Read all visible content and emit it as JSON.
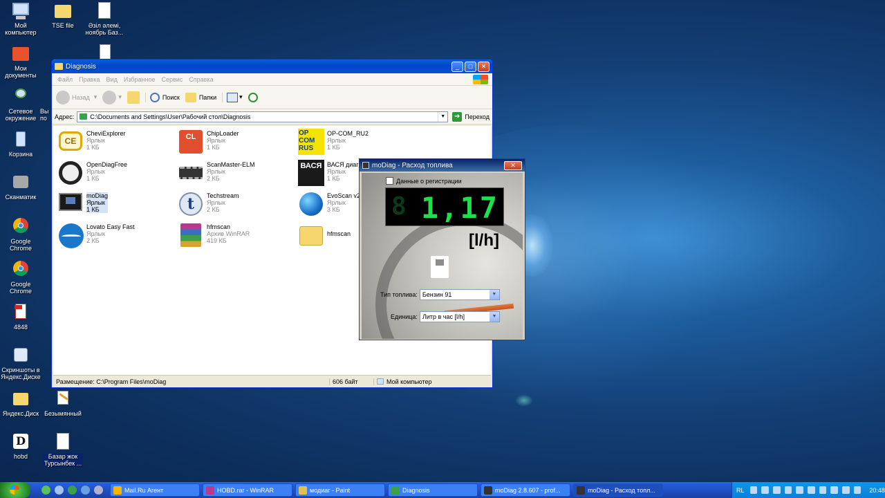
{
  "desktop": {
    "icons": [
      {
        "label": "Мой компьютер"
      },
      {
        "label": "TSE file"
      },
      {
        "label": "Әзіл әлемі, ноябрь Баз..."
      },
      {
        "label": "Мои документы"
      },
      {
        "label": "Сетевое окружение"
      },
      {
        "label": "Корзина"
      },
      {
        "label": "Сканматик"
      },
      {
        "label": "Google Chrome"
      },
      {
        "label": "Google Chrome"
      },
      {
        "label": "4848"
      },
      {
        "label": "Скриншоты в Яндекс.Диске"
      },
      {
        "label": "Яндекс.Диск"
      },
      {
        "label": "Безымянный"
      },
      {
        "label": "hobd"
      },
      {
        "label": "Базар жок Турсынбек ..."
      }
    ],
    "partial_label": "Вы по"
  },
  "explorer": {
    "title": "Diagnosis",
    "menu": [
      "Файл",
      "Правка",
      "Вид",
      "Избранное",
      "Сервис",
      "Справка"
    ],
    "toolbar": {
      "back": "Назад",
      "search": "Поиск",
      "folders": "Папки"
    },
    "address_label": "Адрес:",
    "address_value": "C:\\Documents and Settings\\User\\Рабочий стол\\Diagnosis",
    "go_label": "Переход",
    "files": [
      {
        "name": "CheviExplorer",
        "type": "Ярлык",
        "size": "1 КБ"
      },
      {
        "name": "ChipLoader",
        "type": "Ярлык",
        "size": "1 КБ"
      },
      {
        "name": "OP-COM_RU2",
        "type": "Ярлык",
        "size": "1 КБ"
      },
      {
        "name": "OpenDiagFree",
        "type": "Ярлык",
        "size": "1 КБ"
      },
      {
        "name": "ScanMaster-ELM",
        "type": "Ярлык",
        "size": "2 КБ"
      },
      {
        "name": "ВАСЯ диагн",
        "type": "Ярлык",
        "size": "1 КБ"
      },
      {
        "name": "moDiag",
        "type": "Ярлык",
        "size": "1 КБ"
      },
      {
        "name": "Techstream",
        "type": "Ярлык",
        "size": "2 КБ"
      },
      {
        "name": "EvoScan v2",
        "type": "Ярлык",
        "size": "3 КБ"
      },
      {
        "name": "Lovato Easy Fast",
        "type": "Ярлык",
        "size": "2 КБ"
      },
      {
        "name": "hfmscan",
        "type": "Архив WinRAR",
        "size": "419 КБ"
      },
      {
        "name": "hfmscan",
        "type": "",
        "size": ""
      }
    ],
    "opcom_icon_text": "OP COM RUS",
    "vasya_icon_text": "ВАСЯ",
    "status": {
      "location": "Размещение: C:\\Program Files\\moDiag",
      "size": "606 байт",
      "zone": "Мой компьютер"
    }
  },
  "modiag": {
    "title": "moDiag - Расход топлива",
    "checkbox_label": "Данные о регистрации",
    "lcd_ghost": "8",
    "lcd_value": "1,17",
    "unit": "[l/h]",
    "fuel_type_label": "Тип топлива:",
    "fuel_type_value": "Бензин 91",
    "unit_label": "Единица:",
    "unit_value": "Литр в час [l/h]"
  },
  "taskbar": {
    "tasks": [
      {
        "label": "Mail.Ru Агент"
      },
      {
        "label": "HOBD.rar - WinRAR"
      },
      {
        "label": "модиаг - Paint"
      },
      {
        "label": "Diagnosis"
      },
      {
        "label": "moDiag 2.8.607 - prof..."
      },
      {
        "label": "moDiag - Расход топл..."
      }
    ],
    "lang": "RL",
    "clock": "20:48"
  },
  "colors": {
    "lcd_green": "#1fe04a",
    "xp_blue": "#245edb",
    "title_active": "#0a246a"
  }
}
